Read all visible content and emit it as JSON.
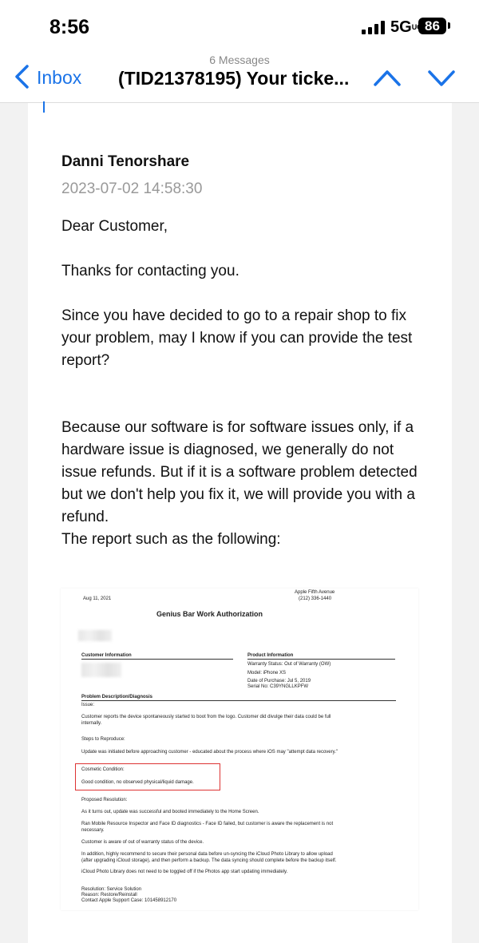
{
  "status": {
    "time": "8:56",
    "network": "5G",
    "network_suffix": "UC",
    "battery": "86"
  },
  "nav": {
    "back_label": "Inbox",
    "message_count": "6 Messages",
    "subject": "(TID21378195) Your ticke..."
  },
  "email": {
    "sender": "Danni Tenorshare",
    "date": "2023-07-02 14:58:30",
    "paragraphs": [
      "Dear Customer,",
      "Thanks for contacting you.",
      "Since you have decided to go to a repair shop to fix your problem, may I know if you can provide the test report?",
      "Because our software is for software issues only, if a hardware issue is diagnosed, we generally do not issue refunds. But if it is a software problem detected but we don't help you fix it, we will provide you with a refund.",
      "The report such as the following:"
    ]
  },
  "report": {
    "date": "Aug 11, 2021",
    "store": "Apple Fifth Avenue",
    "phone": "(212) 336-1440",
    "title": "Genius Bar Work Authorization",
    "customer_info": "Customer Information",
    "product_info": "Product Information",
    "warranty": "Warranty Status: Out of Warranty (OW)",
    "model": "Model: iPhone XS",
    "purchase_date": "Date of Purchase: Jul 5, 2019",
    "serial": "Serial No: C39YNGLLKPFW",
    "problem_heading": "Problem Description/Diagnosis",
    "issue_label": "Issue:",
    "issue_text_1": "Customer reports the device spontaneously started to boot from the  logo. Customer did divulge their data could be full",
    "issue_text_2": "internally.",
    "steps_label": "Steps to Reproduce:",
    "steps_text": "Update was initiated before approaching customer - educated about the process where iOS may \"attempt data recovery.\"",
    "cosmetic_label": "Cosmetic Condition:",
    "cosmetic_text": "Good condition, no observed physical/liquid damage.",
    "resolution_label": "Proposed Resolution:",
    "res_1": "As it turns out, update was successful and booted immediately to the Home Screen.",
    "res_2a": "Ran Mobile Resource Inspector and Face ID diagnostics - Face ID failed, but customer is aware the replacement is not",
    "res_2b": "necessary.",
    "res_3": "Customer is aware of out of warranty status of the device.",
    "res_4a": "In addition, highly recommend to secure their personal data before un-syncing the iCloud Photo Library to allow upload",
    "res_4b": "(after upgrading iCloud storage), and then perform a backup. The data syncing should complete before the backup itself.",
    "res_5": "iCloud Photo Library does not need to be toggled off if the Photos app start updating immediately.",
    "footer_1": "Resolution: Service Solution",
    "footer_2": "Reason: Restore/Reinstall",
    "footer_3": "Contact Apple Support Case: 101458912170"
  },
  "colors": {
    "accent": "#1a73e8",
    "highlight_box": "#dd3333"
  }
}
